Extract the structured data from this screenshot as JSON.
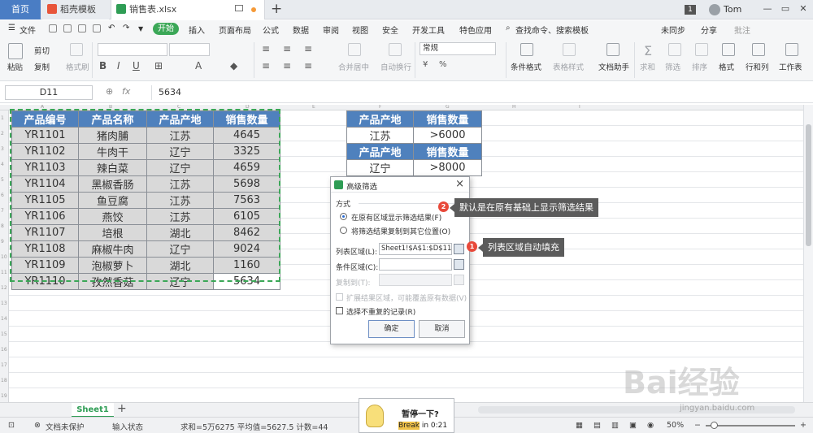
{
  "titlebar": {
    "tabs": [
      "首页",
      "稻壳模板",
      "销售表.xlsx"
    ],
    "new_tab": "+",
    "badge": "1",
    "user": "Tom"
  },
  "menubar": {
    "file": "文件",
    "start": "开始",
    "items": [
      "插入",
      "页面布局",
      "公式",
      "数据",
      "审阅",
      "视图",
      "安全",
      "开发工具",
      "特色应用"
    ],
    "search": "查找命令、搜索模板",
    "sync": "未同步",
    "share": "分享",
    "comment": "批注"
  },
  "ribbon": {
    "paste": "粘贴",
    "cut": "剪切",
    "copy": "复制",
    "format_painter": "格式刷",
    "merge": "合并居中",
    "wrap": "自动换行",
    "number_format": "常规",
    "conditional": "条件格式",
    "table_style": "表格样式",
    "doc_helper": "文档助手",
    "sum": "求和",
    "filter": "筛选",
    "sort": "排序",
    "format": "格式",
    "rowcol": "行和列",
    "sheet": "工作表"
  },
  "formulabar": {
    "cell_ref": "D11",
    "fx": "fx",
    "value": "5634"
  },
  "columns": [
    "A",
    "B",
    "C",
    "D",
    "E",
    "F",
    "G",
    "H",
    "I"
  ],
  "rows": [
    "1",
    "2",
    "3",
    "4",
    "5",
    "6",
    "7",
    "8",
    "9",
    "10",
    "11",
    "12",
    "13",
    "14",
    "15",
    "16",
    "17",
    "18",
    "19"
  ],
  "main_table": {
    "headers": [
      "产品编号",
      "产品名称",
      "产品产地",
      "销售数量"
    ],
    "rows": [
      [
        "YR1101",
        "猪肉脯",
        "江苏",
        "4645"
      ],
      [
        "YR1102",
        "牛肉干",
        "辽宁",
        "3325"
      ],
      [
        "YR1103",
        "辣白菜",
        "辽宁",
        "4659"
      ],
      [
        "YR1104",
        "黑椒香肠",
        "江苏",
        "5698"
      ],
      [
        "YR1105",
        "鱼豆腐",
        "江苏",
        "7563"
      ],
      [
        "YR1106",
        "燕饺",
        "江苏",
        "6105"
      ],
      [
        "YR1107",
        "培根",
        "湖北",
        "8462"
      ],
      [
        "YR1108",
        "麻椒牛肉",
        "辽宁",
        "9024"
      ],
      [
        "YR1109",
        "泡椒萝卜",
        "湖北",
        "1160"
      ],
      [
        "YR1110",
        "孜然香菇",
        "辽宁",
        "5634"
      ]
    ]
  },
  "criteria_table": {
    "rows": [
      [
        "产品产地",
        "销售数量"
      ],
      [
        "江苏",
        ">6000"
      ],
      [
        "产品产地",
        "销售数量"
      ],
      [
        "辽宁",
        ">8000"
      ]
    ]
  },
  "dialog": {
    "title": "高级筛选",
    "mode_label": "方式",
    "option1": "在原有区域显示筛选结果(F)",
    "option2": "将筛选结果复制到其它位置(O)",
    "list_range_label": "列表区域(L):",
    "list_range_value": "Sheet1!$A$1:$D$11",
    "criteria_range_label": "条件区域(C):",
    "criteria_range_value": "",
    "copy_to_label": "复制到(T):",
    "expand_label": "扩展结果区域，可能覆盖原有数据(V)",
    "unique_label": "选择不重复的记录(R)",
    "ok": "确定",
    "cancel": "取消"
  },
  "callouts": {
    "c1_num": "1",
    "c1_text": "列表区域自动填充",
    "c2_num": "2",
    "c2_text": "默认是在原有基础上显示筛选结果"
  },
  "sheetbar": {
    "sheet": "Sheet1",
    "add": "+"
  },
  "statusbar": {
    "protect": "文档未保护",
    "mode": "输入状态",
    "stats": "求和=5万6275  平均值=5627.5  计数=44",
    "zoom": "50%"
  },
  "breakpop": {
    "title": "暂停一下?",
    "timer_prefix": "Break",
    "timer_suffix": "in 0:21"
  },
  "watermark": {
    "logo": "Bai经验",
    "url": "jingyan.baidu.com"
  }
}
